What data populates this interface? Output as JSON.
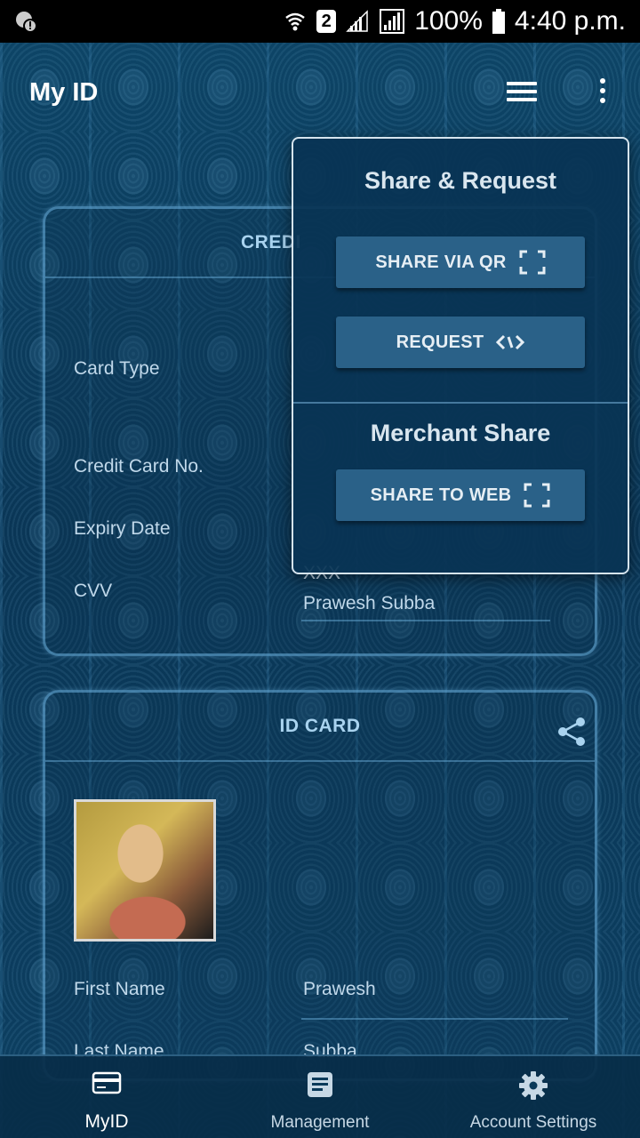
{
  "status_bar": {
    "sim": "2",
    "battery": "100%",
    "time": "4:40 p.m."
  },
  "app_bar": {
    "title": "My ID"
  },
  "credit_card": {
    "title": "CREDI",
    "fields": [
      {
        "label": "Card Type"
      },
      {
        "label": "Credit Card No."
      },
      {
        "label": "Expiry Date"
      },
      {
        "label": "CVV"
      }
    ],
    "cvv_partial": "XXX",
    "holder_name": "Prawesh Subba"
  },
  "id_card": {
    "title": "ID CARD",
    "first_name_label": "First Name",
    "first_name_value": "Prawesh",
    "last_name_label": "Last Name",
    "last_name_value": "Subba"
  },
  "share_menu": {
    "heading": "Share & Request",
    "share_qr_label": "SHARE VIA QR",
    "request_label": "REQUEST",
    "merchant_heading": "Merchant Share",
    "share_web_label": "SHARE TO WEB"
  },
  "bottom_nav": {
    "items": [
      {
        "label": "MyID",
        "icon": "credit-card-icon",
        "active": true
      },
      {
        "label": "Management",
        "icon": "document-icon",
        "active": false
      },
      {
        "label": "Account Settings",
        "icon": "gear-icon",
        "active": false
      }
    ]
  },
  "colors": {
    "background": "#0b3a5a",
    "button": "#2a6188",
    "card_title": "#a9d3ef"
  }
}
